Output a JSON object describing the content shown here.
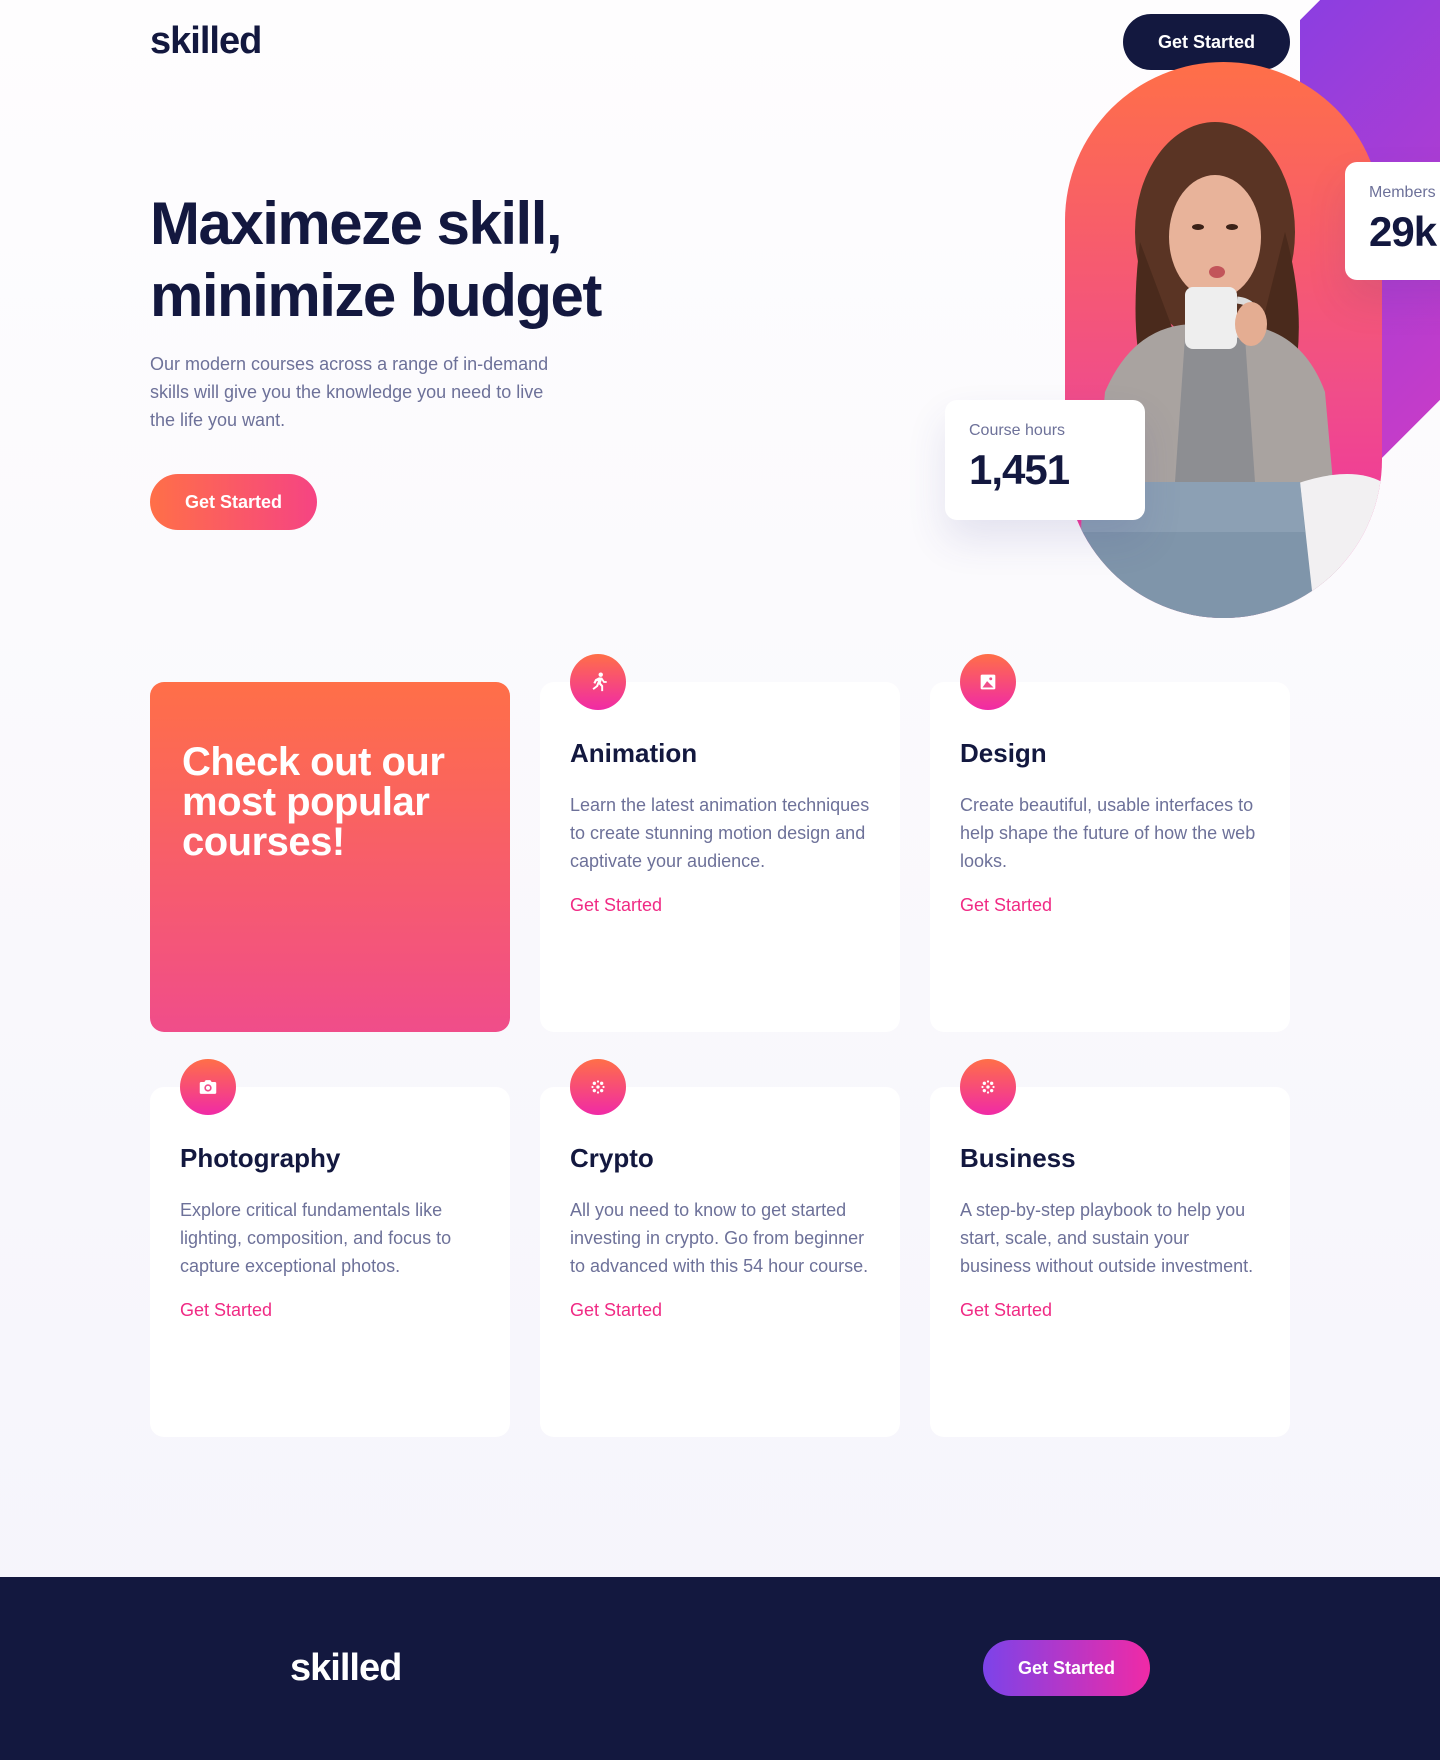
{
  "header": {
    "logo": "skilled",
    "cta_label": "Get Started"
  },
  "hero": {
    "title_line1": "Maximeze skill,",
    "title_line2": "minimize budget",
    "subtitle": "Our modern courses across a range of in-demand skills will give you the knowledge you need to live the life you want.",
    "cta_label": "Get Started",
    "stats": {
      "members_label": "Members",
      "members_value": "29k",
      "hours_label": "Course hours",
      "hours_value": "1,451"
    }
  },
  "courses": {
    "feature_title": "Check out our most popular courses!",
    "items": [
      {
        "icon": "running-figure-icon",
        "title": "Animation",
        "description": "Learn the latest animation techniques to create stunning motion design and captivate your audience.",
        "link": "Get Started"
      },
      {
        "icon": "image-icon",
        "title": "Design",
        "description": "Create beautiful, usable interfaces to help shape the future of how the web looks.",
        "link": "Get Started"
      },
      {
        "icon": "camera-icon",
        "title": "Photography",
        "description": "Explore critical fundamentals like lighting, composition, and focus to capture exceptional photos.",
        "link": "Get Started"
      },
      {
        "icon": "crypto-dots-icon",
        "title": "Crypto",
        "description": "All you need to know to get started investing in crypto. Go from beginner to advanced with this 54 hour course.",
        "link": "Get Started"
      },
      {
        "icon": "business-dots-icon",
        "title": "Business",
        "description": "A step-by-step playbook to help you start, scale, and sustain your business without outside investment.",
        "link": "Get Started"
      }
    ]
  },
  "footer": {
    "logo": "skilled",
    "cta_label": "Get Started"
  },
  "colors": {
    "navy": "#13183f",
    "orange": "#ff6f48",
    "pink": "#f02aa6",
    "purple": "#8d3ee0",
    "muted": "#6d7199"
  }
}
